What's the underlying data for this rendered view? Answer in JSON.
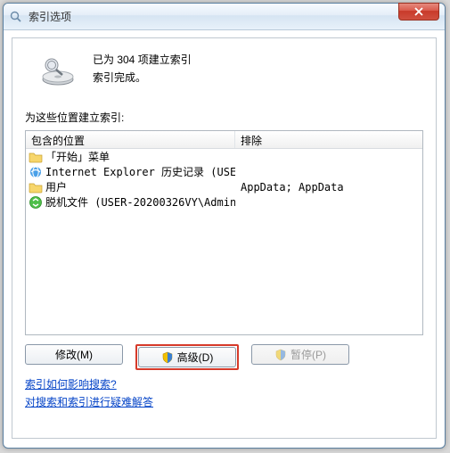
{
  "window": {
    "title": "索引选项",
    "close_label": "X"
  },
  "status": {
    "line1": "已为 304 项建立索引",
    "line2": "索引完成。"
  },
  "section_label": "为这些位置建立索引:",
  "columns": {
    "left": "包含的位置",
    "right": "排除"
  },
  "rows": [
    {
      "icon": "folder",
      "label": "「开始」菜单",
      "exclude": ""
    },
    {
      "icon": "ie",
      "label": "Internet Explorer 历史记录 (USE...",
      "exclude": ""
    },
    {
      "icon": "folder",
      "label": "用户",
      "exclude": "AppData; AppData"
    },
    {
      "icon": "offline",
      "label": "脱机文件 (USER-20200326VY\\Admin...",
      "exclude": ""
    }
  ],
  "buttons": {
    "modify": "修改(M)",
    "advanced": "高级(D)",
    "pause": "暂停(P)"
  },
  "links": {
    "link1": "索引如何影响搜索?",
    "link2": "对搜索和索引进行疑难解答"
  }
}
